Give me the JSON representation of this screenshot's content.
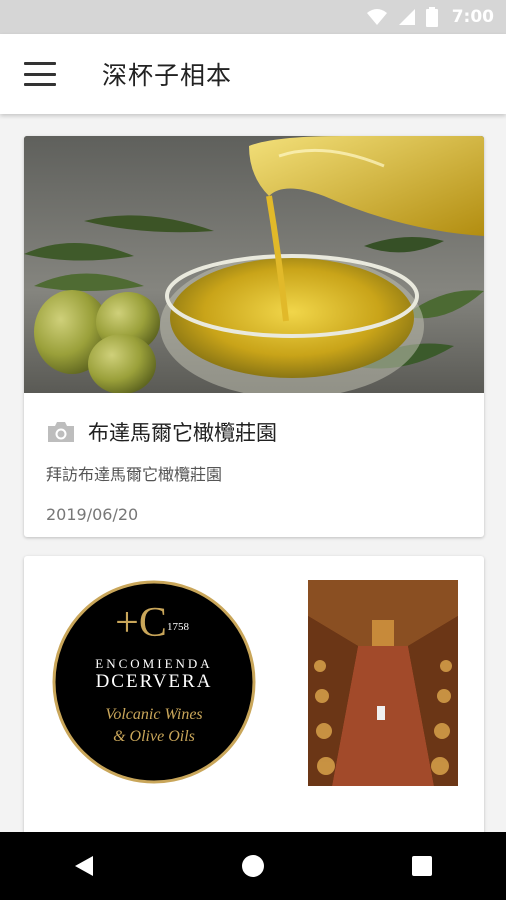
{
  "status_bar": {
    "time": "7:00",
    "icons": [
      "wifi-icon",
      "signal-icon",
      "battery-icon"
    ]
  },
  "app_bar": {
    "title": "深杯子相本",
    "menu_icon": "menu-icon"
  },
  "albums": [
    {
      "image": "olive-oil-photo",
      "title": "布達馬爾它橄欖莊園",
      "subtitle": "拜訪布達馬爾它橄欖莊園",
      "date": "2019/06/20"
    },
    {
      "logo": {
        "year": "1758",
        "line1": "ENCOMIENDA",
        "line2": "DCERVERA",
        "tagline1": "Volcanic Wines",
        "tagline2": "& Olive Oils"
      },
      "image": "wine-cellar-photo"
    }
  ],
  "nav": [
    "back-icon",
    "home-icon",
    "recents-icon"
  ],
  "colors": {
    "status_bar": "#d6d6d6",
    "logo_gold": "#c9a65a",
    "nav_bar": "#000000"
  }
}
